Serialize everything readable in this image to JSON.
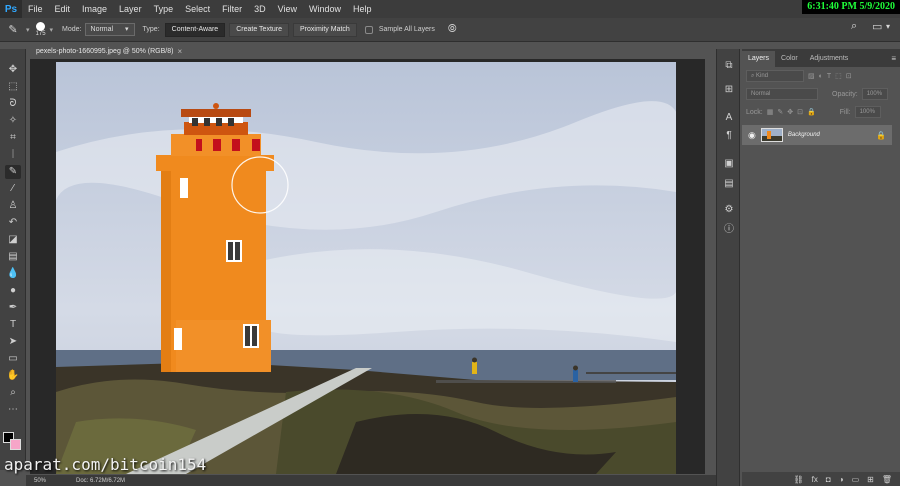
{
  "app": {
    "logo": "Ps"
  },
  "menu": [
    "File",
    "Edit",
    "Image",
    "Layer",
    "Type",
    "Select",
    "Filter",
    "3D",
    "View",
    "Window",
    "Help"
  ],
  "clock": "6:31:40 PM 5/9/2020",
  "options": {
    "brush_size": "175",
    "mode_label": "Mode:",
    "mode_value": "Normal",
    "type_label": "Type:",
    "type_buttons": [
      "Content-Aware",
      "Create Texture",
      "Proximity Match"
    ],
    "sample_all_layers": "Sample All Layers"
  },
  "document": {
    "tab_title": "pexels-photo-1660995.jpeg @ 50% (RGB/8)",
    "zoom": "50%",
    "doc_size": "Doc: 6.72M/6.72M"
  },
  "panel": {
    "tabs": [
      "Layers",
      "Color",
      "Adjustments"
    ],
    "kind_placeholder": "Kind",
    "blend_mode": "Normal",
    "opacity_label": "Opacity:",
    "opacity_value": "100%",
    "lock_label": "Lock:",
    "fill_label": "Fill:",
    "fill_value": "100%",
    "layer_name": "Background"
  },
  "watermark": "aparat.com/bitcoin154",
  "colors": {
    "accent": "#31a8ff",
    "clock_text": "#1fff3a",
    "lighthouse": "#f08a1e"
  }
}
